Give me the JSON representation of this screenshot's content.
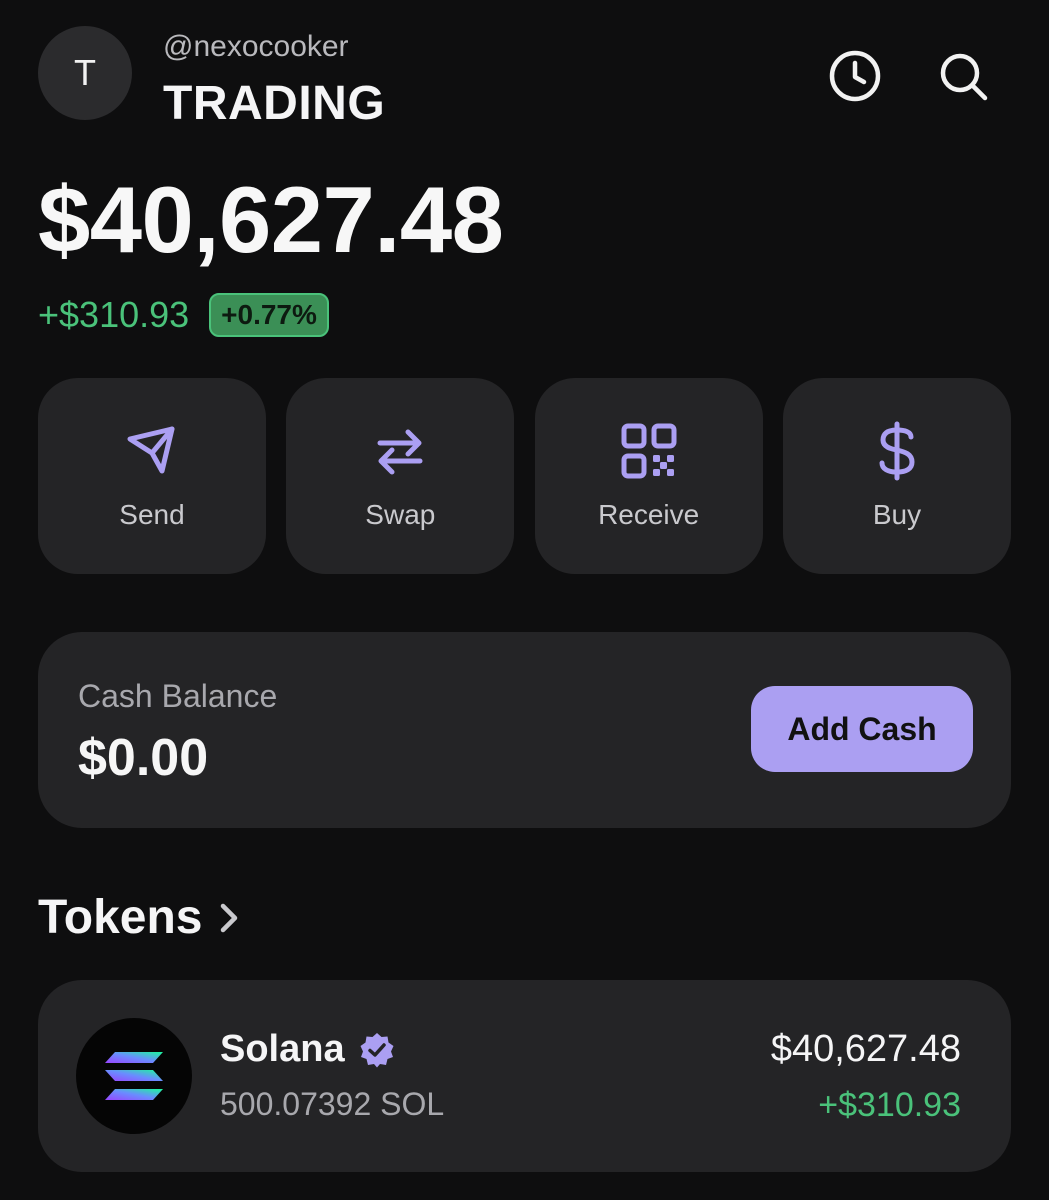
{
  "header": {
    "avatar_letter": "T",
    "username": "@nexocooker",
    "account_name": "TRADING",
    "icons": [
      "clock-icon",
      "search-icon"
    ]
  },
  "portfolio": {
    "balance": "$40,627.48",
    "change_amount": "+$310.93",
    "change_percent": "+0.77%"
  },
  "actions": [
    {
      "label": "Send",
      "icon": "send-icon"
    },
    {
      "label": "Swap",
      "icon": "swap-icon"
    },
    {
      "label": "Receive",
      "icon": "qr-code-icon"
    },
    {
      "label": "Buy",
      "icon": "dollar-icon"
    }
  ],
  "cash": {
    "title": "Cash Balance",
    "value": "$0.00",
    "button_label": "Add Cash"
  },
  "tokens": {
    "title": "Tokens",
    "items": [
      {
        "name": "Solana",
        "amount": "500.07392 SOL",
        "value": "$40,627.48",
        "change": "+$310.93",
        "verified": true
      }
    ]
  },
  "colors": {
    "background": "#0e0e0f",
    "card": "#242426",
    "accent": "#ab9ff2",
    "positive": "#4ac27a"
  }
}
